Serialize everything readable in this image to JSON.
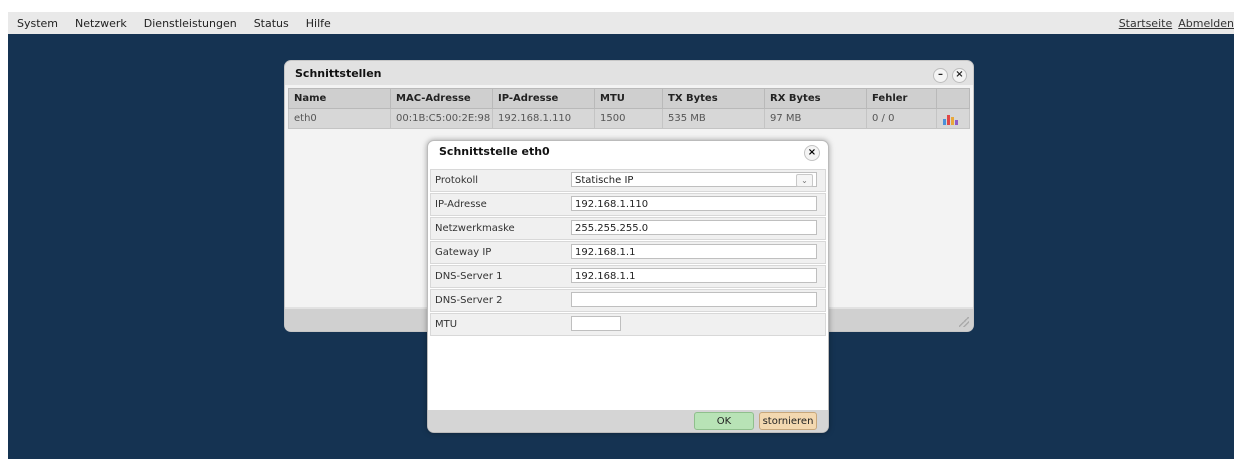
{
  "menubar": {
    "left_items": [
      "System",
      "Netzwerk",
      "Dienstleistungen",
      "Status",
      "Hilfe"
    ],
    "right_items": [
      "Startseite",
      "Abmelden"
    ]
  },
  "interfaces_panel": {
    "title": "Schnittstellen",
    "minimize_label": "–",
    "close_label": "×",
    "columns": [
      "Name",
      "MAC-Adresse",
      "IP-Adresse",
      "MTU",
      "TX Bytes",
      "RX Bytes",
      "Fehler",
      ""
    ],
    "rows": [
      {
        "name": "eth0",
        "mac": "00:1B:C5:00:2E:98",
        "ip": "192.168.1.110",
        "mtu": "1500",
        "tx": "535 MB",
        "rx": "97 MB",
        "errors": "0 / 0",
        "icon": "bar-chart-icon"
      }
    ]
  },
  "dialog": {
    "title": "Schnittstelle eth0",
    "close_label": "×",
    "fields": [
      {
        "label": "Protokoll",
        "value": "Statische IP",
        "type": "select"
      },
      {
        "label": "IP-Adresse",
        "value": "192.168.1.110",
        "type": "text"
      },
      {
        "label": "Netzwerkmaske",
        "value": "255.255.255.0",
        "type": "text"
      },
      {
        "label": "Gateway IP",
        "value": "192.168.1.1",
        "type": "text"
      },
      {
        "label": "DNS-Server 1",
        "value": "192.168.1.1",
        "type": "text"
      },
      {
        "label": "DNS-Server 2",
        "value": "",
        "type": "text"
      },
      {
        "label": "MTU",
        "value": "",
        "type": "text"
      }
    ],
    "ok_label": "OK",
    "cancel_label": "stornieren"
  },
  "colors": {
    "background": "#153352",
    "ok_button": "#b8e3b6",
    "cancel_button": "#f3d8b0"
  }
}
